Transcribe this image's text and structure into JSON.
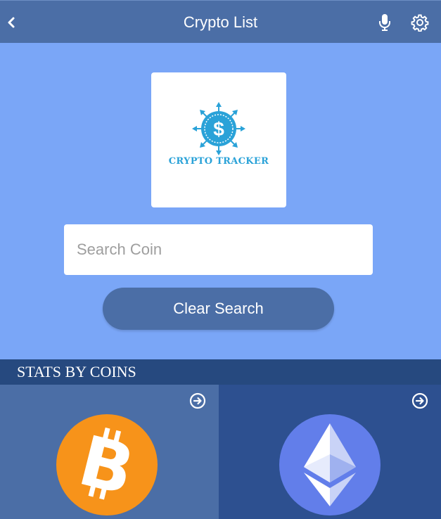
{
  "header": {
    "title": "Crypto List",
    "icons": {
      "back": "chevron-left-icon",
      "mic": "microphone-icon",
      "settings": "gear-icon"
    }
  },
  "logo": {
    "text": "CRYPTO TRACKER",
    "icon": "dollar-coin-arrows-icon",
    "color": "#2aa2d8"
  },
  "search": {
    "value": "",
    "placeholder": "Search Coin"
  },
  "clear_button": {
    "label": "Clear Search"
  },
  "stats": {
    "title": "STATS BY COINS",
    "coins": [
      {
        "icon": "bitcoin-icon",
        "arrow_icon": "arrow-right-circle-icon",
        "color": "#f7931a"
      },
      {
        "icon": "ethereum-icon",
        "arrow_icon": "arrow-right-circle-icon",
        "color": "#627eea"
      }
    ]
  },
  "colors": {
    "header_bg": "#4b6ea6",
    "page_bg": "#7aa6f7",
    "section_bg": "#26497f",
    "card_btc_bg": "#4b6ea6",
    "card_eth_bg": "#2d5090"
  }
}
